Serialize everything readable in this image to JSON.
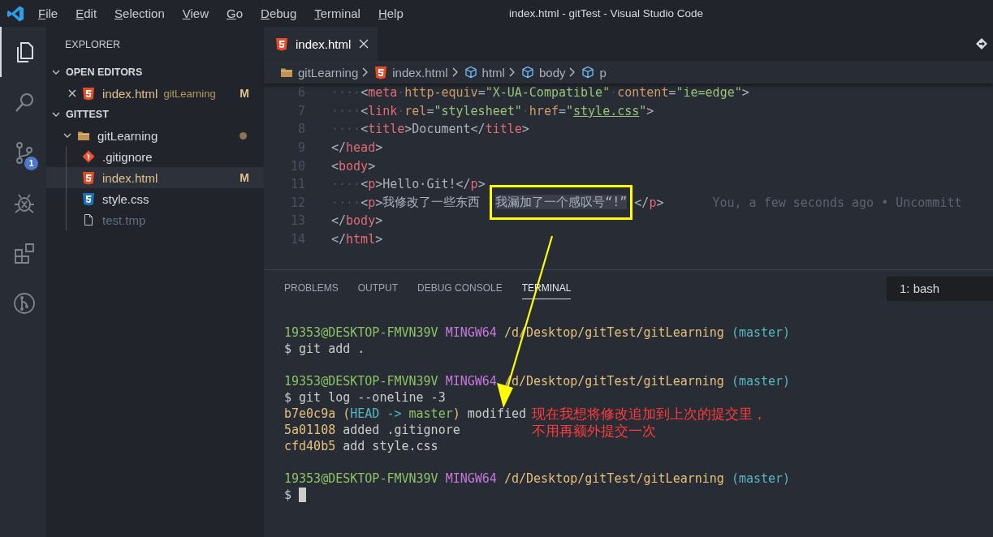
{
  "window": {
    "title": "index.html - gitTest - Visual Studio Code"
  },
  "menu": [
    "File",
    "Edit",
    "Selection",
    "View",
    "Go",
    "Debug",
    "Terminal",
    "Help"
  ],
  "activity_bar": [
    {
      "kind": "files",
      "selected": true
    },
    {
      "kind": "search",
      "selected": false
    },
    {
      "kind": "scm",
      "selected": false,
      "badge": "1"
    },
    {
      "kind": "debug",
      "selected": false
    },
    {
      "kind": "extensions",
      "selected": false
    },
    {
      "kind": "graph",
      "selected": false
    }
  ],
  "sidebar": {
    "title": "EXPLORER",
    "sections": [
      {
        "title": "OPEN EDITORS",
        "expanded": true,
        "items": [
          {
            "name": "index.html",
            "kind": "html",
            "folder": "gitLearning",
            "status": "M",
            "selected": false
          }
        ]
      },
      {
        "title": "GITTEST",
        "expanded": true,
        "tree": [
          {
            "name": "gitLearning",
            "kind": "folder",
            "expanded": true,
            "modified_dot": true,
            "selected": false,
            "children": [
              {
                "name": ".gitignore",
                "kind": "git",
                "selected": false,
                "ignored": false
              },
              {
                "name": "index.html",
                "kind": "html",
                "status": "M",
                "selected": true,
                "ignored": false
              },
              {
                "name": "style.css",
                "kind": "css",
                "selected": false,
                "ignored": false
              },
              {
                "name": "test.tmp",
                "kind": "file",
                "selected": false,
                "ignored": true
              }
            ]
          }
        ]
      }
    ]
  },
  "editor": {
    "tabs": [
      {
        "name": "index.html",
        "kind": "html",
        "selected": true
      }
    ],
    "breadcrumbs": [
      {
        "text": "gitLearning",
        "kind": "folder"
      },
      {
        "text": "index.html",
        "kind": "html"
      },
      {
        "text": "html",
        "kind": "element"
      },
      {
        "text": "body",
        "kind": "element"
      },
      {
        "text": "p",
        "kind": "element"
      }
    ],
    "lines": [
      {
        "number": "6",
        "tokens": [
          {
            "kind": "space",
            "text": "····"
          },
          {
            "kind": "punct",
            "text": "<"
          },
          {
            "kind": "tag",
            "text": "meta"
          },
          {
            "kind": "space",
            "text": "·"
          },
          {
            "kind": "attr",
            "text": "http-equiv"
          },
          {
            "kind": "punct",
            "text": "="
          },
          {
            "kind": "string",
            "text": "\"X-UA-Compatible\""
          },
          {
            "kind": "space",
            "text": "·"
          },
          {
            "kind": "attr",
            "text": "content"
          },
          {
            "kind": "punct",
            "text": "="
          },
          {
            "kind": "string",
            "text": "\"ie=edge\""
          },
          {
            "kind": "punct",
            "text": ">"
          }
        ]
      },
      {
        "number": "7",
        "tokens": [
          {
            "kind": "space",
            "text": "····"
          },
          {
            "kind": "punct",
            "text": "<"
          },
          {
            "kind": "tag",
            "text": "link"
          },
          {
            "kind": "space",
            "text": "·"
          },
          {
            "kind": "attr",
            "text": "rel"
          },
          {
            "kind": "punct",
            "text": "="
          },
          {
            "kind": "string",
            "text": "\"stylesheet\""
          },
          {
            "kind": "space",
            "text": "·"
          },
          {
            "kind": "attr",
            "text": "href"
          },
          {
            "kind": "punct",
            "text": "="
          },
          {
            "kind": "string",
            "text": "\""
          },
          {
            "kind": "link",
            "text": "style.css"
          },
          {
            "kind": "string",
            "text": "\""
          },
          {
            "kind": "punct",
            "text": ">"
          }
        ]
      },
      {
        "number": "8",
        "tokens": [
          {
            "kind": "space",
            "text": "····"
          },
          {
            "kind": "punct",
            "text": "<"
          },
          {
            "kind": "tag",
            "text": "title"
          },
          {
            "kind": "punct",
            "text": ">"
          },
          {
            "kind": "text",
            "text": "Document"
          },
          {
            "kind": "punct",
            "text": "</"
          },
          {
            "kind": "tag",
            "text": "title"
          },
          {
            "kind": "punct",
            "text": ">"
          }
        ]
      },
      {
        "number": "9",
        "tokens": [
          {
            "kind": "punct",
            "text": "</"
          },
          {
            "kind": "tag",
            "text": "head"
          },
          {
            "kind": "punct",
            "text": ">"
          }
        ]
      },
      {
        "number": "10",
        "tokens": [
          {
            "kind": "punct",
            "text": "<"
          },
          {
            "kind": "tag",
            "text": "body"
          },
          {
            "kind": "punct",
            "text": ">"
          }
        ]
      },
      {
        "number": "11",
        "tokens": [
          {
            "kind": "space",
            "text": "····"
          },
          {
            "kind": "punct",
            "text": "<"
          },
          {
            "kind": "tag",
            "text": "p"
          },
          {
            "kind": "punct",
            "text": ">"
          },
          {
            "kind": "text",
            "text": "Hello·Git!"
          },
          {
            "kind": "punct",
            "text": "</"
          },
          {
            "kind": "tag",
            "text": "p"
          },
          {
            "kind": "punct",
            "text": ">"
          }
        ]
      },
      {
        "number": "12",
        "tokens": [
          {
            "kind": "space",
            "text": "····"
          },
          {
            "kind": "punct",
            "text": "<"
          },
          {
            "kind": "tag",
            "text": "p"
          },
          {
            "kind": "punct",
            "text": ">"
          },
          {
            "kind": "text",
            "text": "我修改了一些东西"
          },
          {
            "kind": "marked",
            "text": "我漏加了一个感叹号“!”"
          },
          {
            "kind": "punct",
            "text": "</"
          },
          {
            "kind": "tag",
            "text": "p"
          },
          {
            "kind": "punct",
            "text": ">"
          }
        ],
        "blame": "You, a few seconds ago • Uncommitt"
      },
      {
        "number": "13",
        "tokens": [
          {
            "kind": "punct",
            "text": "</"
          },
          {
            "kind": "tag",
            "text": "body"
          },
          {
            "kind": "punct",
            "text": ">"
          }
        ]
      },
      {
        "number": "14",
        "tokens": [
          {
            "kind": "punct",
            "text": "</"
          },
          {
            "kind": "tag",
            "text": "html"
          },
          {
            "kind": "punct",
            "text": ">"
          }
        ]
      }
    ]
  },
  "panel": {
    "tabs": [
      {
        "label": "PROBLEMS",
        "selected": false
      },
      {
        "label": "OUTPUT",
        "selected": false
      },
      {
        "label": "DEBUG CONSOLE",
        "selected": false
      },
      {
        "label": "TERMINAL",
        "selected": true
      }
    ],
    "terminal_select": "1: bash",
    "lines": [
      {
        "kind": "output",
        "tokens": [
          {
            "kind": "user",
            "text": "19353@DESKTOP-FMVN39V"
          },
          {
            "kind": "system",
            "text": " MINGW64"
          },
          {
            "kind": "path",
            "text": " /d/Desktop/gitTest/gitLearning"
          },
          {
            "kind": "branch",
            "text": " (master)"
          }
        ]
      },
      {
        "kind": "output",
        "tokens": [
          {
            "kind": "plain",
            "text": "$ git add ."
          }
        ]
      },
      {
        "kind": "blank"
      },
      {
        "kind": "output",
        "tokens": [
          {
            "kind": "user",
            "text": "19353@DESKTOP-FMVN39V"
          },
          {
            "kind": "system",
            "text": " MINGW64"
          },
          {
            "kind": "path",
            "text": " /d/Desktop/gitTest/gitLearning"
          },
          {
            "kind": "branch",
            "text": " (master)"
          }
        ]
      },
      {
        "kind": "output",
        "tokens": [
          {
            "kind": "plain",
            "text": "$ git log --oneline -3"
          }
        ]
      },
      {
        "kind": "output",
        "tokens": [
          {
            "kind": "path",
            "text": "b7e0c9a"
          },
          {
            "kind": "path",
            "text": " ("
          },
          {
            "kind": "branch",
            "text": "HEAD -> "
          },
          {
            "kind": "user",
            "text": "master"
          },
          {
            "kind": "path",
            "text": ")"
          },
          {
            "kind": "plain",
            "text": " modified"
          }
        ]
      },
      {
        "kind": "output",
        "tokens": [
          {
            "kind": "path",
            "text": "5a01108"
          },
          {
            "kind": "plain",
            "text": " added .gitignore"
          }
        ]
      },
      {
        "kind": "output",
        "tokens": [
          {
            "kind": "path",
            "text": "cfd40b5"
          },
          {
            "kind": "plain",
            "text": " add style.css"
          }
        ]
      },
      {
        "kind": "blank"
      },
      {
        "kind": "output",
        "tokens": [
          {
            "kind": "user",
            "text": "19353@DESKTOP-FMVN39V"
          },
          {
            "kind": "system",
            "text": " MINGW64"
          },
          {
            "kind": "path",
            "text": " /d/Desktop/gitTest/gitLearning"
          },
          {
            "kind": "branch",
            "text": " (master)"
          }
        ]
      },
      {
        "kind": "output",
        "cursor": true,
        "tokens": [
          {
            "kind": "plain",
            "text": "$ "
          }
        ]
      }
    ]
  },
  "annotation": {
    "note": [
      "现在我想将修改追加到上次的提交里，",
      "不用再额外提交一次"
    ]
  }
}
